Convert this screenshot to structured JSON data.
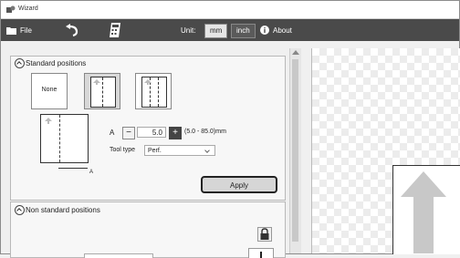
{
  "window": {
    "title": "Wizard"
  },
  "toolbar": {
    "file_label": "File",
    "unit_label": "Unit:",
    "unit_options": [
      "mm",
      "inch"
    ],
    "selected_unit": "mm",
    "about_label": "About"
  },
  "standard_positions": {
    "title": "Standard positions",
    "preset_none_label": "None",
    "selected_preset": 1,
    "a_label": "A",
    "minus_label": "−",
    "plus_label": "+",
    "a_value": "5.0",
    "range_text": "(5.0 - 85.0)mm",
    "marker_label": "A",
    "tool_type_label": "Tool type",
    "tool_type_value": "Perf.",
    "apply_label": "Apply"
  },
  "non_standard_positions": {
    "title": "Non standard positions"
  }
}
